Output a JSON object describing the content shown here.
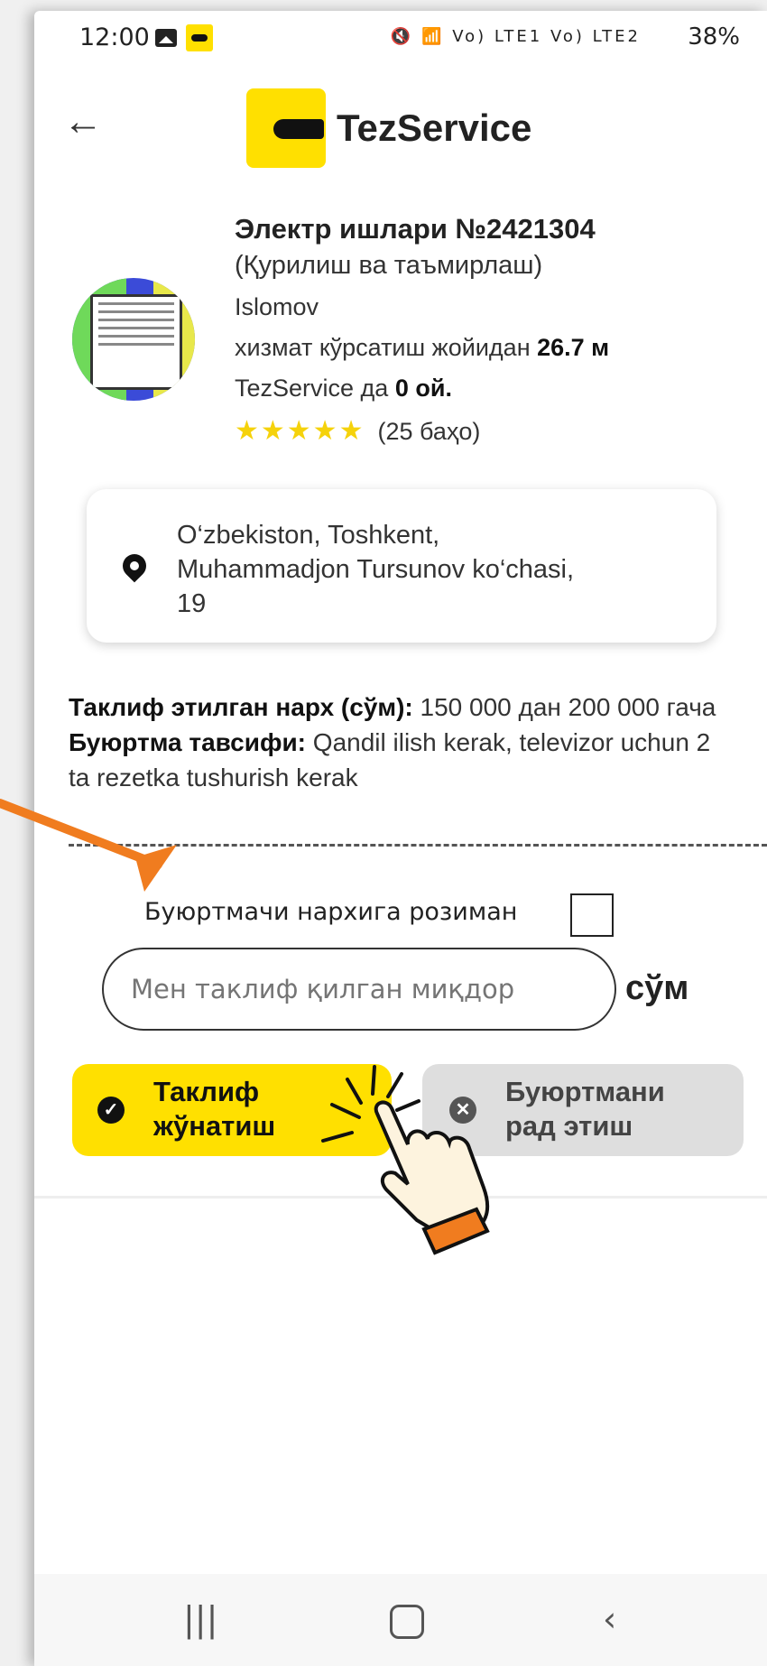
{
  "status_bar": {
    "time": "12:00",
    "indicators": "Vo) LTE1 Vo) LTE2",
    "battery": "38%"
  },
  "header": {
    "back_icon": "arrow-left-icon",
    "logo_text": "TezService"
  },
  "service": {
    "title": "Электр ишлари №2421304",
    "category": "(Қурилиш ва таъмирлаш)",
    "customer": "Islomov",
    "distance_label": "хизмат кўрсатиш жойидан",
    "distance_value": "26.7 м",
    "membership_label": "TezService да",
    "membership_value": "0 ой.",
    "stars": "★★★★★",
    "rating_count": "(25 баҳо)"
  },
  "address": {
    "line1": "O‘zbekiston, Toshkent,",
    "line2": "Muhammadjon Tursunov ko‘chasi,",
    "line3": "19"
  },
  "order": {
    "price_label": "Таклиф этилган нарх (сўм):",
    "price_range": "150 000 дан 200 000 гача",
    "desc_label": "Буюртма тавсифи:",
    "desc_value": "Qandil ilish kerak, televizor uchun 2 ta rezetka tushurish kerak"
  },
  "offer": {
    "agree_label": "Буюртмачи нархига розиман",
    "amount_placeholder": "Мен таклиф қилган миқдор",
    "currency": "сўм"
  },
  "buttons": {
    "send_line1": "Таклиф",
    "send_line2": "жўнатиш",
    "reject_line1": "Буюртмани",
    "reject_line2": "рад этиш"
  },
  "nav": {
    "recents_icon": "recents-icon",
    "home_icon": "home-icon",
    "back_icon": "back-icon"
  },
  "colors": {
    "accent": "#FFE000",
    "annotation": "#F07C1F",
    "reject_bg": "#DEDEDE"
  }
}
